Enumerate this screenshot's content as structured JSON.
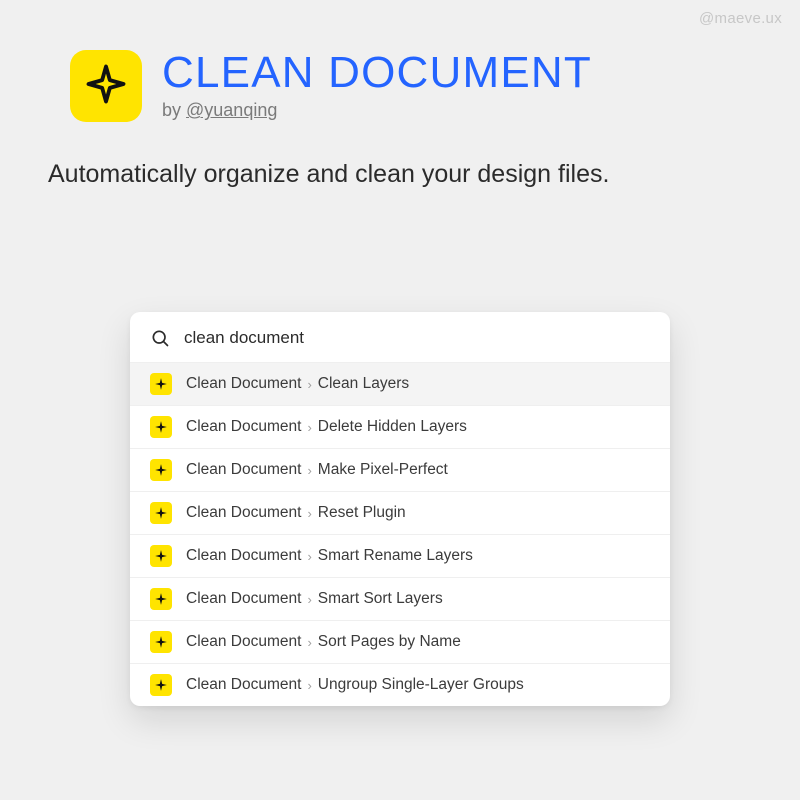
{
  "watermark": "@maeve.ux",
  "header": {
    "title": "CLEAN DOCUMENT",
    "byline_prefix": "by ",
    "author_handle": "@yuanqing"
  },
  "description": "Automatically organize and clean your design files.",
  "palette": {
    "search_value": "clean document",
    "parent": "Clean Document",
    "items": [
      {
        "action": "Clean Layers",
        "highlight": true
      },
      {
        "action": "Delete Hidden Layers",
        "highlight": false
      },
      {
        "action": "Make Pixel-Perfect",
        "highlight": false
      },
      {
        "action": "Reset Plugin",
        "highlight": false
      },
      {
        "action": "Smart Rename Layers",
        "highlight": false
      },
      {
        "action": "Smart Sort Layers",
        "highlight": false
      },
      {
        "action": "Sort Pages by Name",
        "highlight": false
      },
      {
        "action": "Ungroup Single-Layer Groups",
        "highlight": false
      }
    ]
  },
  "colors": {
    "accent_blue": "#2464ff",
    "icon_yellow": "#ffe400",
    "bg": "#f0f0f0"
  }
}
